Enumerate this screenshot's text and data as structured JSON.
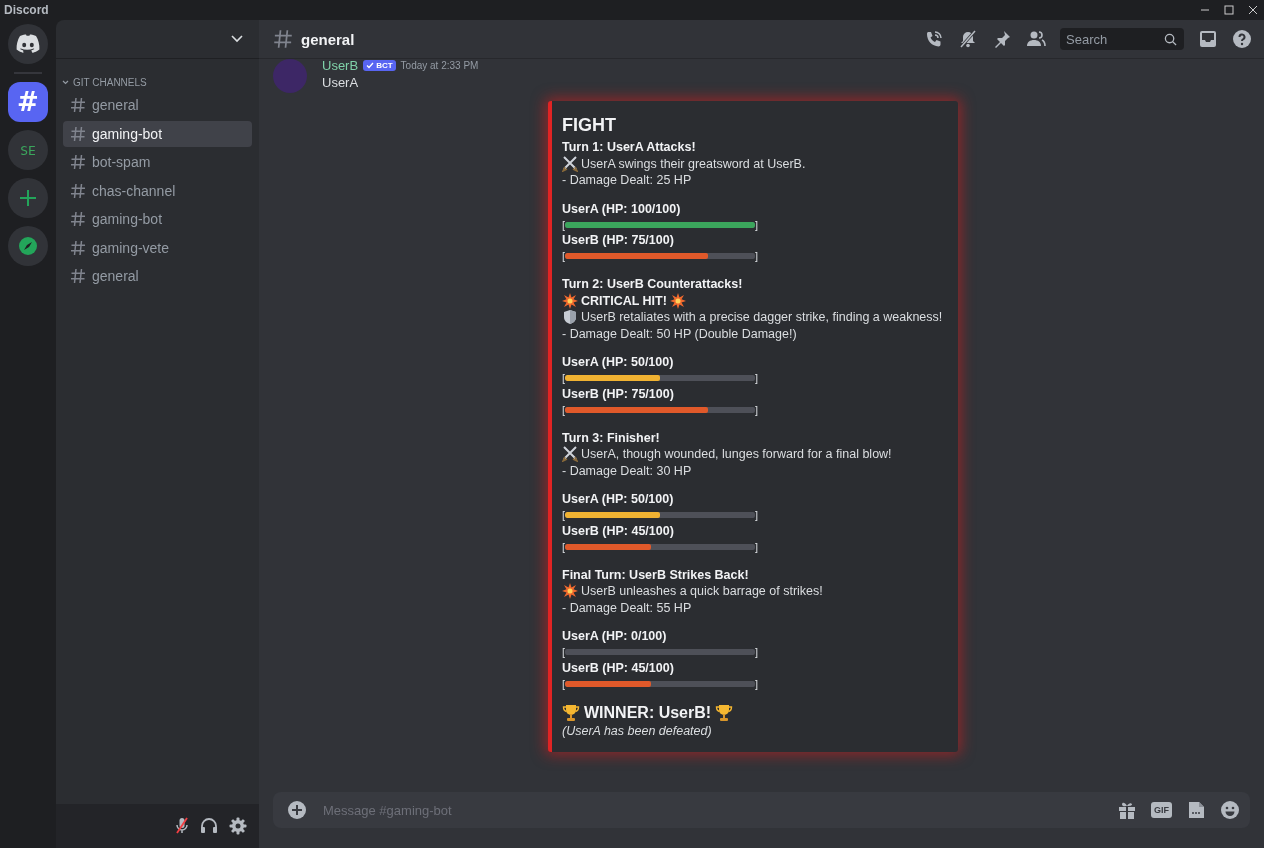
{
  "window": {
    "title": "Discord"
  },
  "servers": [
    {
      "kind": "home",
      "selected": false
    },
    {
      "kind": "text",
      "text": "#",
      "selected": true
    },
    {
      "kind": "text",
      "text": "SE",
      "selected": false
    },
    {
      "kind": "add",
      "selected": false
    },
    {
      "kind": "explore",
      "selected": false
    }
  ],
  "sidebar": {
    "category": "GIT CHANNELS",
    "expanded": true,
    "channels": [
      {
        "name": "general",
        "selected": false
      },
      {
        "name": "gaming-bot",
        "selected": true
      },
      {
        "name": "bot-spam",
        "selected": false
      },
      {
        "name": "chas-channel",
        "selected": false
      },
      {
        "name": "gaming-bot",
        "selected": false
      },
      {
        "name": "gaming-vete",
        "selected": false
      },
      {
        "name": "general",
        "selected": false
      }
    ]
  },
  "header": {
    "channel": "general",
    "search": {
      "placeholder": "Search"
    }
  },
  "message": {
    "author": "UserB",
    "badge": "BCT",
    "time": "Today at 2:33 PM",
    "text": "UserA",
    "embed": {
      "title": "FIGHT",
      "turns": [
        {
          "heading": "Turn 1: UserA Attacks!",
          "action": {
            "kind": "swords",
            "text": "UserA swings their greatsword at UserB."
          },
          "damage": "- Damage Dealt: 25 HP",
          "bars": [
            {
              "label": "UserA (HP: 100/100)",
              "open": "[",
              "close": "]",
              "level": 1,
              "color": "#3ba55c"
            },
            {
              "label": "UserB (HP: 75/100)",
              "open": "[",
              "close": "]",
              "level": 0.75,
              "color": "#e0592a"
            }
          ]
        },
        {
          "heading": "Turn 2: UserB Counterattacks!",
          "critical": "CRITICAL HIT!",
          "action": {
            "kind": "shield",
            "text": "UserB retaliates with a precise dagger strike, finding a weakness!"
          },
          "damage": "- Damage Dealt: 50 HP (Double Damage!)",
          "bars": [
            {
              "label": "UserA (HP: 50/100)",
              "open": "[",
              "close": "]",
              "level": 0.5,
              "color": "#f0b232"
            },
            {
              "label": "UserB (HP: 75/100)",
              "open": "[",
              "close": "]",
              "level": 0.75,
              "color": "#e0592a"
            }
          ]
        },
        {
          "heading": "Turn 3: Finisher!",
          "action": {
            "kind": "swords",
            "text": "UserA, though wounded, lunges forward for a final blow!"
          },
          "damage": "- Damage Dealt: 30 HP",
          "bars": [
            {
              "label": "UserA (HP: 50/100)",
              "open": "[",
              "close": "]",
              "level": 0.5,
              "color": "#f0b232"
            },
            {
              "label": "UserB (HP: 45/100)",
              "open": "[",
              "close": "]",
              "level": 0.45,
              "color": "#e0592a"
            }
          ]
        },
        {
          "heading": "Final Turn: UserB Strikes Back!",
          "action": {
            "kind": "burst",
            "text": "UserB unleashes a quick barrage of strikes!"
          },
          "damage": "- Damage Dealt: 55 HP",
          "bars": [
            {
              "label": "UserA (HP: 0/100)",
              "open": "[",
              "close": "]",
              "level": 0
            },
            {
              "label": "UserB (HP: 45/100)",
              "open": "[",
              "close": "]",
              "level": 0.45,
              "color": "#e0592a"
            }
          ]
        }
      ],
      "winner": "WINNER: UserB!",
      "note": "(UserA has been defeated)"
    }
  },
  "composer": {
    "placeholder": "Message #gaming-bot",
    "gif": "GIF"
  }
}
